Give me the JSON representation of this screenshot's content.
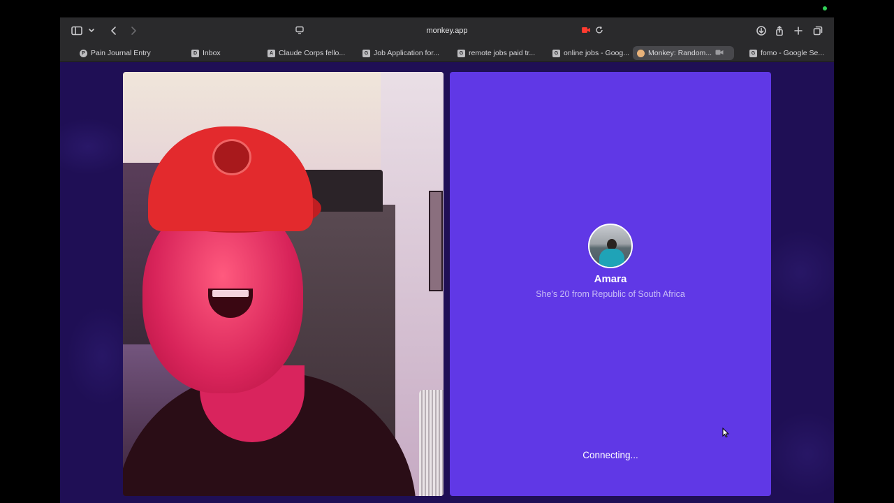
{
  "browser": {
    "url": "monkey.app",
    "tabs": [
      {
        "label": "Pain Journal Entry",
        "favicon": "P"
      },
      {
        "label": "Inbox",
        "favicon": "D"
      },
      {
        "label": "Claude Corps fello...",
        "favicon": "A"
      },
      {
        "label": "Job Application for...",
        "favicon": "G"
      },
      {
        "label": "remote jobs paid tr...",
        "favicon": "G"
      },
      {
        "label": "online jobs - Goog...",
        "favicon": "G"
      },
      {
        "label": "Monkey: Random...",
        "favicon": "",
        "active": true
      },
      {
        "label": "fomo - Google Se...",
        "favicon": "G"
      }
    ]
  },
  "call": {
    "match_name": "Amara",
    "match_details": "She's 20 from Republic of South Africa",
    "status": "Connecting..."
  },
  "colors": {
    "page_bg": "#1f0f55",
    "panel_bg": "#6038e6",
    "toolbar_bg": "#2a2a2c"
  }
}
